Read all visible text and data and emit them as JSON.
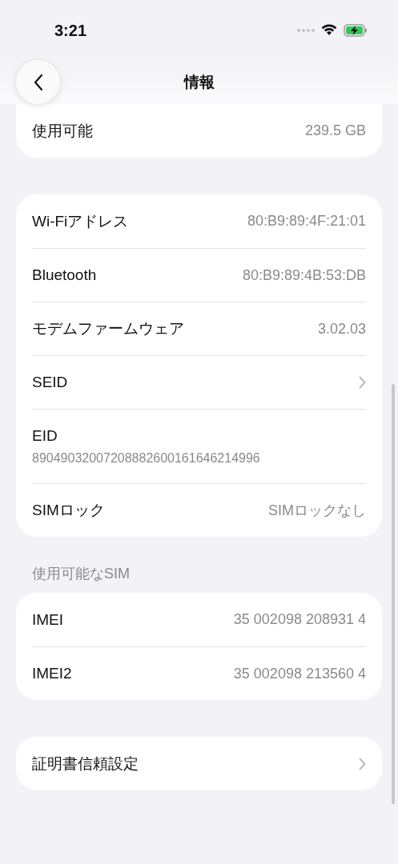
{
  "status_bar": {
    "time": "3:21"
  },
  "nav": {
    "title": "情報"
  },
  "sections": [
    {
      "cut_top": true,
      "rows": [
        {
          "kind": "value",
          "label": "使用可能",
          "value": "239.5 GB"
        }
      ]
    },
    {
      "rows": [
        {
          "kind": "value",
          "label": "Wi-Fiアドレス",
          "value": "80:B9:89:4F:21:01"
        },
        {
          "kind": "value",
          "label": "Bluetooth",
          "value": "80:B9:89:4B:53:DB"
        },
        {
          "kind": "value",
          "label": "モデムファームウェア",
          "value": "3.02.03"
        },
        {
          "kind": "chevron",
          "label": "SEID"
        },
        {
          "kind": "stacked",
          "label": "EID",
          "value": "89049032007208882600161646214996"
        },
        {
          "kind": "value",
          "label": "SIMロック",
          "value": "SIMロックなし"
        }
      ]
    },
    {
      "header": "使用可能なSIM",
      "rows": [
        {
          "kind": "value",
          "label": "IMEI",
          "value": "35 002098 208931 4"
        },
        {
          "kind": "value",
          "label": "IMEI2",
          "value": "35 002098 213560 4"
        }
      ]
    },
    {
      "rows": [
        {
          "kind": "chevron",
          "label": "証明書信頼設定"
        }
      ]
    }
  ]
}
